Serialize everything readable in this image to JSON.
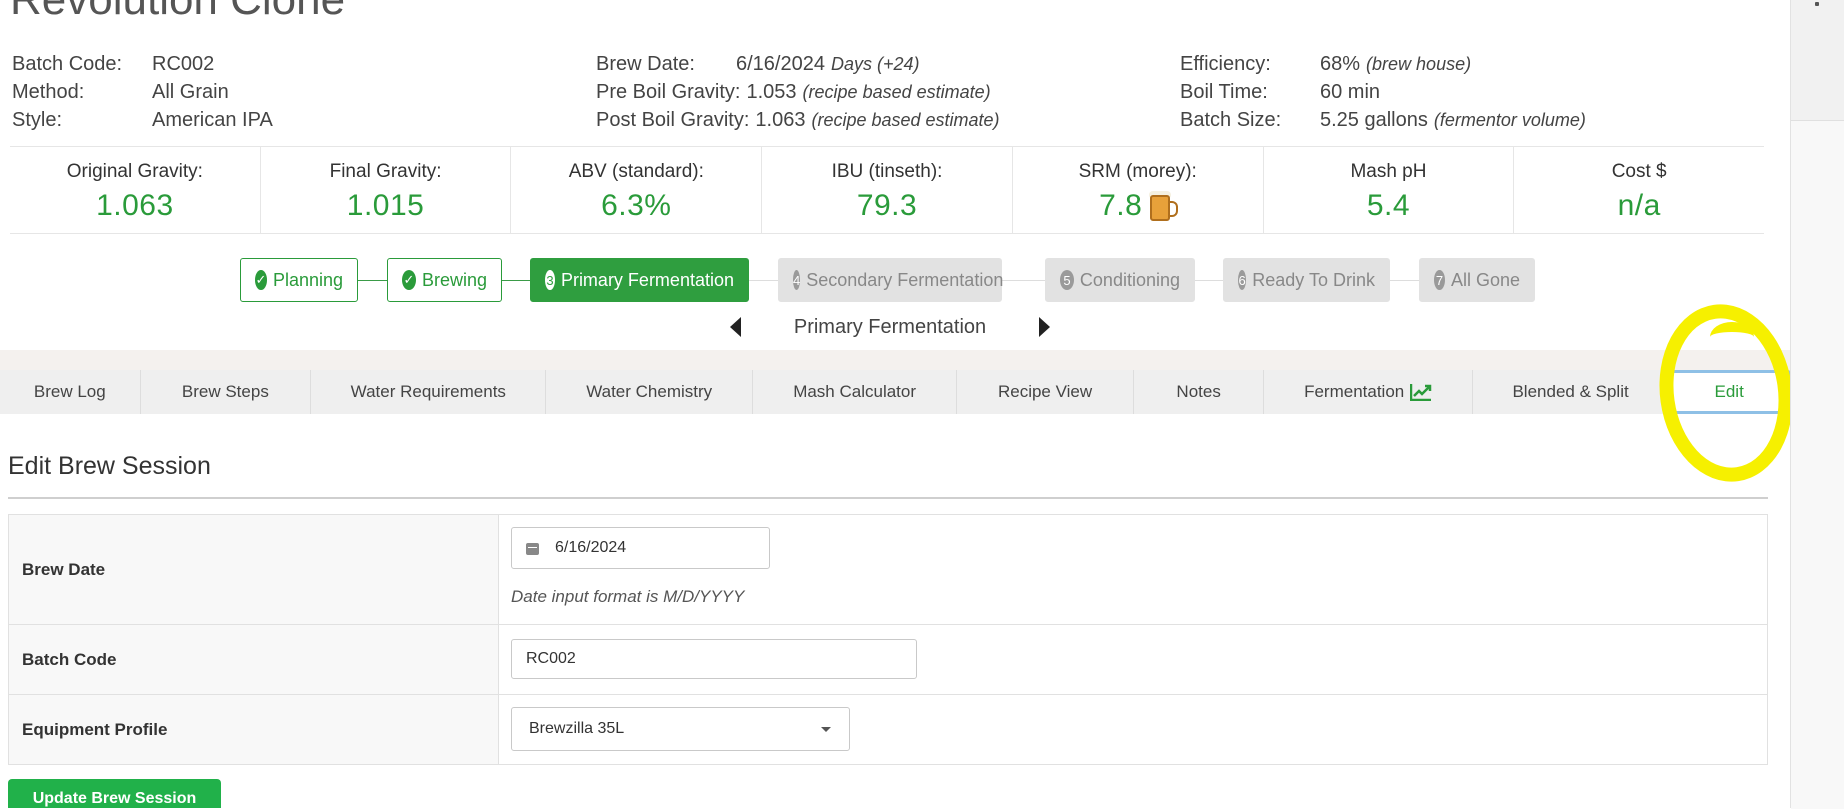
{
  "title": "Revolution Clone",
  "meta": {
    "col1": [
      {
        "label": "Batch Code:",
        "value": "RC002",
        "note": ""
      },
      {
        "label": "Method:",
        "value": "All Grain",
        "note": ""
      },
      {
        "label": "Style:",
        "value": "American IPA",
        "note": ""
      }
    ],
    "col2": [
      {
        "label": "Brew Date:",
        "value": "6/16/2024",
        "note": "Days (+24)"
      },
      {
        "label": "Pre Boil Gravity:",
        "value": "1.053",
        "note": "(recipe based estimate)"
      },
      {
        "label": "Post Boil Gravity:",
        "value": "1.063",
        "note": "(recipe based estimate)"
      }
    ],
    "col3": [
      {
        "label": "Efficiency:",
        "value": "68%",
        "note": "(brew house)"
      },
      {
        "label": "Boil Time:",
        "value": "60 min",
        "note": ""
      },
      {
        "label": "Batch Size:",
        "value": "5.25 gallons",
        "note": "(fermentor volume)"
      }
    ]
  },
  "stats": [
    {
      "label": "Original Gravity:",
      "value": "1.063"
    },
    {
      "label": "Final Gravity:",
      "value": "1.015"
    },
    {
      "label": "ABV (standard):",
      "value": "6.3%"
    },
    {
      "label": "IBU (tinseth):",
      "value": "79.3"
    },
    {
      "label": "SRM (morey):",
      "value": "7.8",
      "icon": "beer-mug-icon"
    },
    {
      "label": "Mash pH",
      "value": "5.4"
    },
    {
      "label": "Cost $",
      "value": "n/a"
    }
  ],
  "stages": [
    {
      "num": "",
      "label": "Planning",
      "state": "done"
    },
    {
      "num": "",
      "label": "Brewing",
      "state": "done"
    },
    {
      "num": "3",
      "label": "Primary Fermentation",
      "state": "active"
    },
    {
      "num": "4",
      "label": "Secondary Fermentation",
      "state": "pending"
    },
    {
      "num": "5",
      "label": "Conditioning",
      "state": "pending"
    },
    {
      "num": "6",
      "label": "Ready To Drink",
      "state": "pending"
    },
    {
      "num": "7",
      "label": "All Gone",
      "state": "pending"
    }
  ],
  "current_stage": "Primary Fermentation",
  "tabs": [
    {
      "label": "Brew Log"
    },
    {
      "label": "Brew Steps"
    },
    {
      "label": "Water Requirements"
    },
    {
      "label": "Water Chemistry"
    },
    {
      "label": "Mash Calculator"
    },
    {
      "label": "Recipe View"
    },
    {
      "label": "Notes"
    },
    {
      "label": "Fermentation",
      "icon": "line-chart-icon"
    },
    {
      "label": "Blended & Split"
    },
    {
      "label": "Edit",
      "active": true
    }
  ],
  "edit": {
    "heading": "Edit Brew Session",
    "brew_date_label": "Brew Date",
    "brew_date_value": "6/16/2024",
    "date_hint": "Date input format is M/D/YYYY",
    "batch_code_label": "Batch Code",
    "batch_code_value": "RC002",
    "equipment_label": "Equipment Profile",
    "equipment_value": "Brewzilla 35L",
    "submit_label": "Update Brew Session"
  },
  "colors": {
    "accent_green": "#2a9b3a",
    "button_green": "#21b14a",
    "highlight_yellow": "#f6f000",
    "active_tab_border": "#8ec0e6"
  }
}
